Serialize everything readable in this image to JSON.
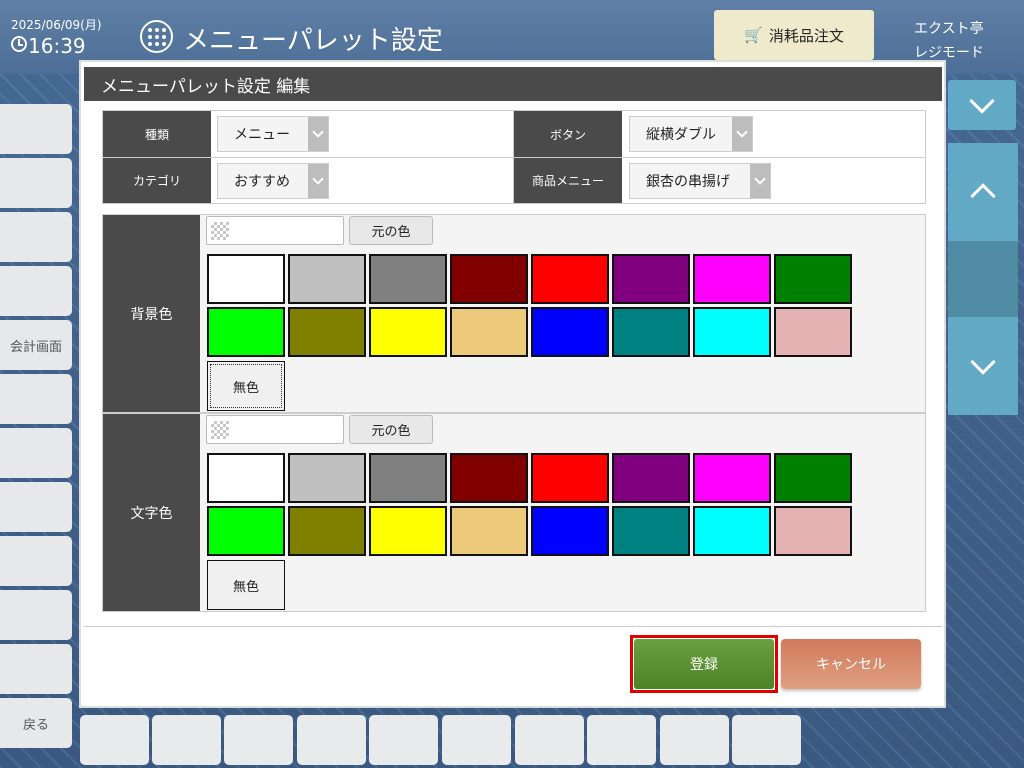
{
  "header": {
    "date": "2025/06/09(月)",
    "time": "16:39",
    "app_title": "メニューパレット設定",
    "supply_order_label": "消耗品注文",
    "store_name": "エクスト亭",
    "mode_name": "レジモード"
  },
  "left_nav": {
    "checkout_label": "会計画面",
    "back_label": "戻る"
  },
  "modal": {
    "title": "メニューパレット設定 編集",
    "fields": {
      "type_label": "種類",
      "type_value": "メニュー",
      "button_label": "ボタン",
      "button_value": "縦横ダブル",
      "category_label": "カテゴリ",
      "category_value": "おすすめ",
      "product_label": "商品メニュー",
      "product_value": "銀杏の串揚げ"
    },
    "background": {
      "label": "背景色",
      "original_color_label": "元の色",
      "no_color_label": "無色"
    },
    "text": {
      "label": "文字色",
      "original_color_label": "元の色",
      "no_color_label": "無色"
    },
    "palette": [
      "#ffffff",
      "#c0c0c0",
      "#808080",
      "#800000",
      "#ff0000",
      "#800080",
      "#ff00ff",
      "#008000",
      "#00ff00",
      "#808000",
      "#ffff00",
      "#edc97c",
      "#0000ff",
      "#008080",
      "#00ffff",
      "#e4b2b2"
    ],
    "register_label": "登録",
    "cancel_label": "キャンセル"
  },
  "colors": {
    "header_bg": "#4a4a4a",
    "register_green": "#5a922f",
    "cancel_orange": "#d88866",
    "highlight_red": "#e00000",
    "right_panel_blue": "#62a9c6"
  }
}
